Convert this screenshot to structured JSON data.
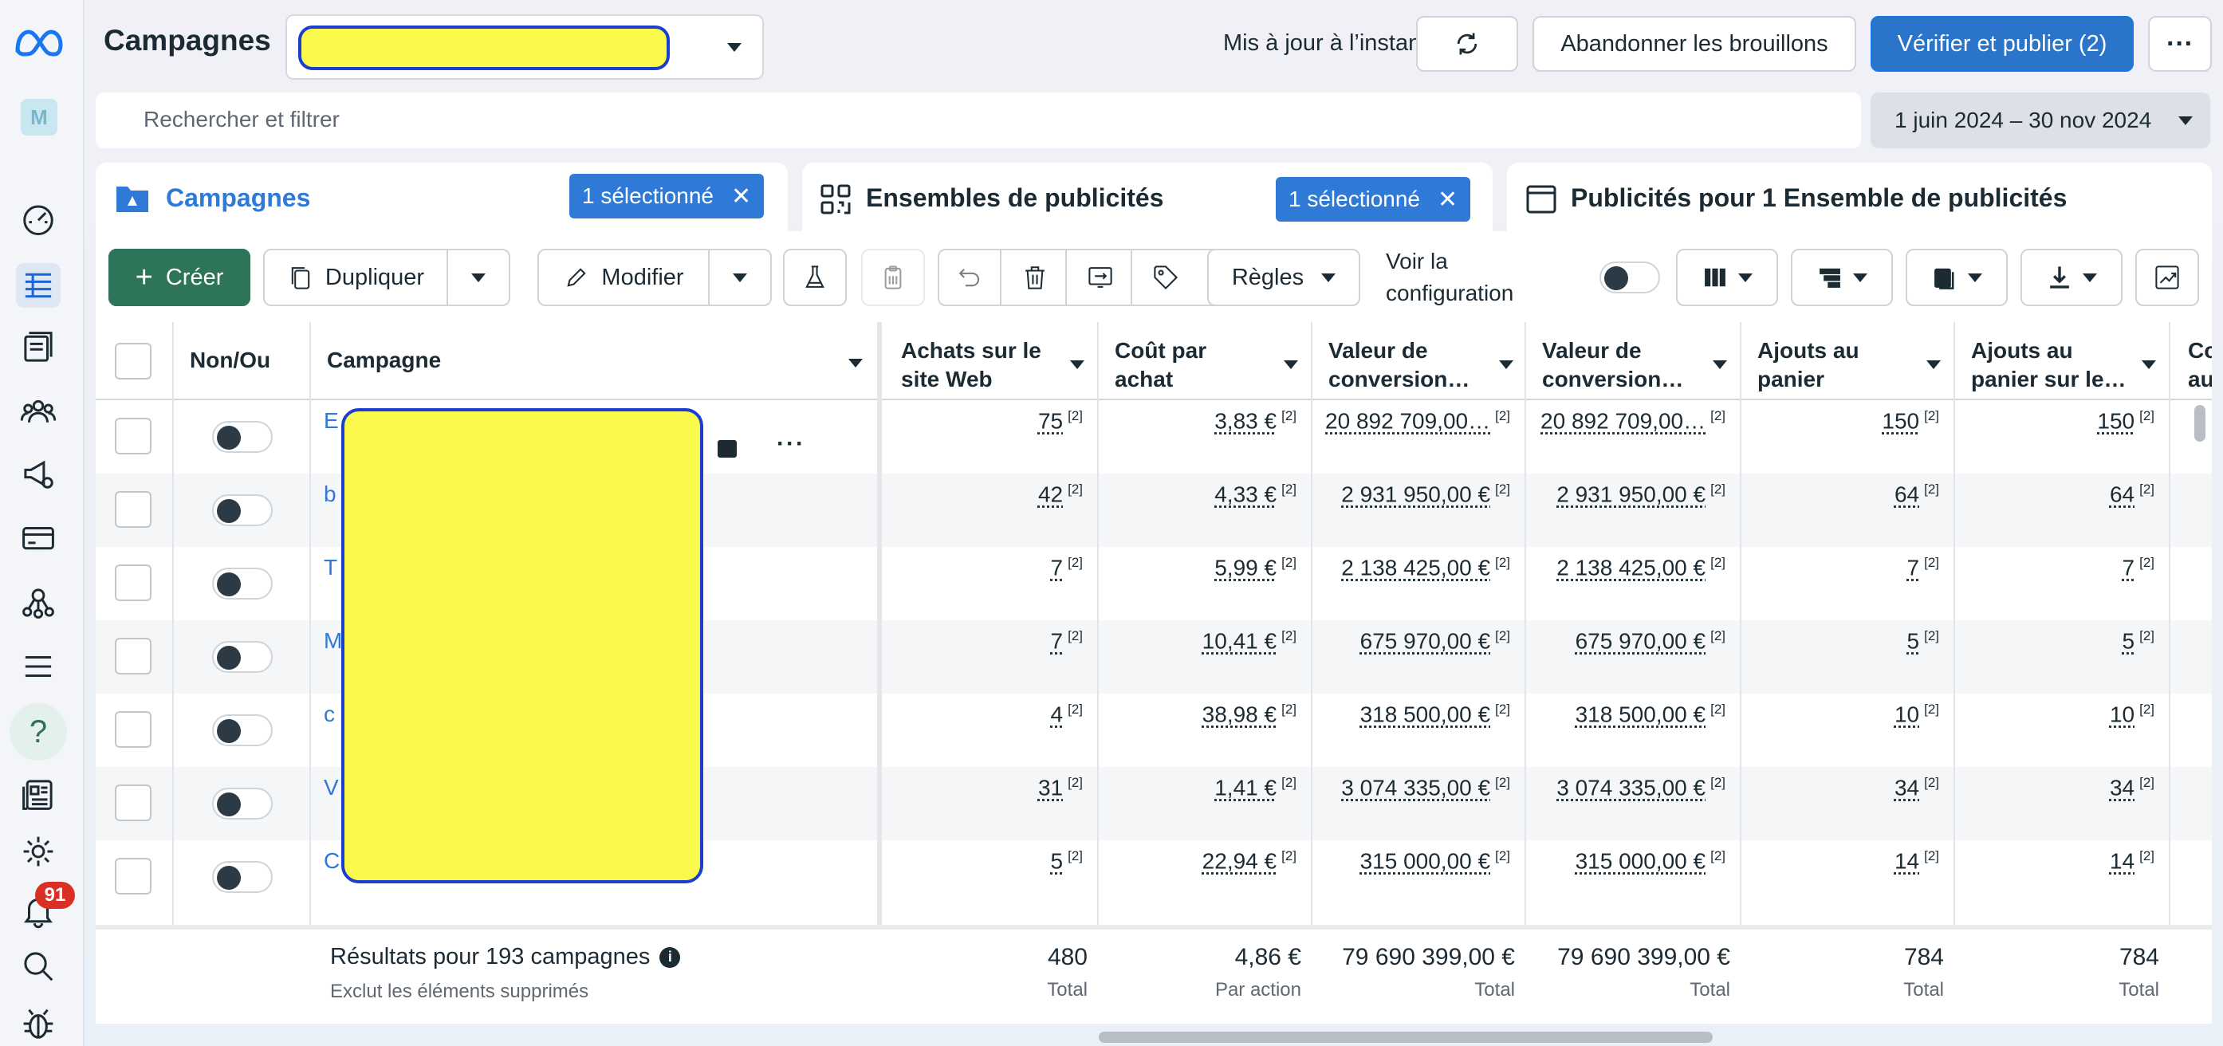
{
  "header": {
    "title": "Campagnes",
    "update_status": "Mis à jour à l’instant",
    "discard_label": "Abandonner les brouillons",
    "publish_label": "Vérifier et publier (2)"
  },
  "search": {
    "placeholder": "Rechercher et filtrer"
  },
  "date_range": "1 juin 2024 – 30 nov 2024",
  "rail": {
    "avatar_letter": "M",
    "notifications": "91"
  },
  "tabs": [
    {
      "label": "Campagnes",
      "badge": "1 sélectionné"
    },
    {
      "label": "Ensembles de publicités",
      "badge": "1 sélectionné"
    },
    {
      "label": "Publicités pour 1 Ensemble de publicités"
    }
  ],
  "toolbar": {
    "create": "Créer",
    "duplicate": "Dupliquer",
    "edit": "Modifier",
    "rules": "Règles",
    "view_config_line1": "Voir la",
    "view_config_line2": "configuration"
  },
  "columns": {
    "onoff": "Non/Ou",
    "campaign": "Campagne",
    "purchases_l1": "Achats sur le",
    "purchases_l2": "site Web",
    "cpa_l1": "Coût par",
    "cpa_l2": "achat",
    "conv1_l1": "Valeur de",
    "conv1_l2": "conversion…",
    "conv2_l1": "Valeur de",
    "conv2_l2": "conversion…",
    "cart_l1": "Ajouts au",
    "cart_l2": "panier",
    "cart_site_l1": "Ajouts au",
    "cart_site_l2": "panier sur le…",
    "next_l1": "Co",
    "next_l2": "au"
  },
  "rows": [
    {
      "initial": "E",
      "purchases": "75",
      "cpa": "3,83 €",
      "conv1": "20 892 709,00…",
      "conv2": "20 892 709,00…",
      "cart": "150",
      "cart_site": "150"
    },
    {
      "initial": "b",
      "purchases": "42",
      "cpa": "4,33 €",
      "conv1": "2 931 950,00 €",
      "conv2": "2 931 950,00 €",
      "cart": "64",
      "cart_site": "64"
    },
    {
      "initial": "T",
      "purchases": "7",
      "cpa": "5,99 €",
      "conv1": "2 138 425,00 €",
      "conv2": "2 138 425,00 €",
      "cart": "7",
      "cart_site": "7"
    },
    {
      "initial": "M",
      "purchases": "7",
      "cpa": "10,41 €",
      "conv1": "675 970,00 €",
      "conv2": "675 970,00 €",
      "cart": "5",
      "cart_site": "5"
    },
    {
      "initial": "c",
      "purchases": "4",
      "cpa": "38,98 €",
      "conv1": "318 500,00 €",
      "conv2": "318 500,00 €",
      "cart": "10",
      "cart_site": "10"
    },
    {
      "initial": "V",
      "purchases": "31",
      "cpa": "1,41 €",
      "conv1": "3 074 335,00 €",
      "conv2": "3 074 335,00 €",
      "cart": "34",
      "cart_site": "34"
    },
    {
      "initial": "C",
      "purchases": "5",
      "cpa": "22,94 €",
      "conv1": "315 000,00 €",
      "conv2": "315 000,00 €",
      "cart": "14",
      "cart_site": "14"
    }
  ],
  "sup": "[2]",
  "footer": {
    "results": "Résultats pour 193 campagnes",
    "excluded": "Exclut les éléments supprimés",
    "purchases": "480",
    "purchases_sub": "Total",
    "cpa": "4,86 €",
    "cpa_sub": "Par action",
    "conv1": "79 690 399,00 €",
    "conv1_sub": "Total",
    "conv2": "79 690 399,00 €",
    "conv2_sub": "Total",
    "cart": "784",
    "cart_sub": "Total",
    "cart_site": "784",
    "cart_site_sub": "Total"
  }
}
